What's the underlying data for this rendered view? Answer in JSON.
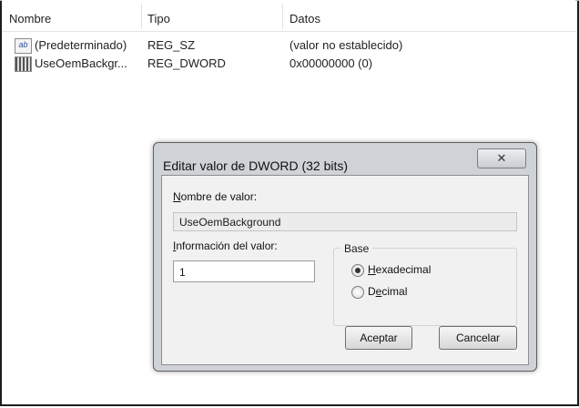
{
  "list": {
    "headers": [
      "Nombre",
      "Tipo",
      "Datos"
    ],
    "rows": [
      {
        "icon": "string-value-icon",
        "name": "(Predeterminado)",
        "type": "REG_SZ",
        "data": "(valor no establecido)"
      },
      {
        "icon": "binary-value-icon",
        "name": "UseOemBackgr...",
        "type": "REG_DWORD",
        "data": "0x00000000 (0)"
      }
    ]
  },
  "dialog": {
    "title": "Editar valor de DWORD (32 bits)",
    "close_glyph": "✕",
    "name_label_first": "N",
    "name_label_rest": "ombre de valor:",
    "name_value": "UseOemBackground",
    "info_label_first": "I",
    "info_label_rest": "nformación del valor:",
    "info_value": "1",
    "base_label": "Base",
    "hex_first": "H",
    "hex_rest": "exadecimal",
    "dec_first": "D",
    "dec_mid": "e",
    "dec_rest": "cimal",
    "hex_selected": true,
    "accept": "Aceptar",
    "cancel": "Cancelar"
  }
}
